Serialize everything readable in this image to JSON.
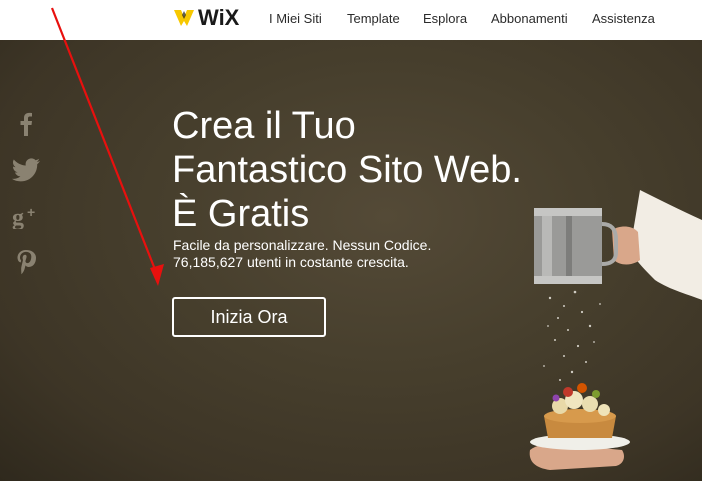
{
  "header": {
    "logo_text": "WiX",
    "nav": [
      "I Miei Siti",
      "Template",
      "Esplora",
      "Abbonamenti",
      "Assistenza"
    ]
  },
  "hero": {
    "headline": [
      "Crea il Tuo",
      "Fantastico Sito Web.",
      "È Gratis"
    ],
    "subline": [
      "Facile da personalizzare. Nessun Codice.",
      "76,185,627 utenti in costante crescita."
    ],
    "cta_label": "Inizia Ora"
  },
  "social": {
    "icons": [
      "facebook-icon",
      "twitter-icon",
      "google-plus-icon",
      "pinterest-icon"
    ]
  },
  "colors": {
    "hero_bg": "#473f2d",
    "nav_text": "#2b2b2b",
    "logo_accent": "#f7c800",
    "social_icon": "#8a8271",
    "annotation": "#e8100e"
  }
}
